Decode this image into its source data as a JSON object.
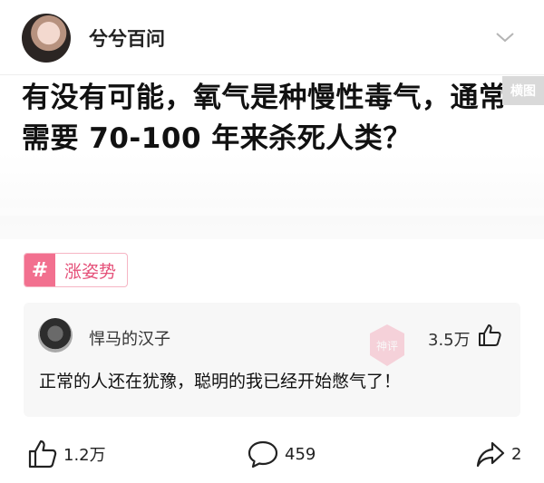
{
  "header": {
    "author_name": "兮兮百问",
    "avatar_icon": "user-avatar",
    "expand_icon": "chevron-down-icon"
  },
  "post": {
    "title": "有没有可能，氧气是种慢性毒气，通常需要 70-100 年来杀死人类？",
    "image_badge": "横图"
  },
  "topic": {
    "hash": "#",
    "label": "涨姿势"
  },
  "top_comment": {
    "user": "悍马的汉子",
    "likes": "3.5万",
    "text": "正常的人还在犹豫，聪明的我已经开始憋气了！",
    "watermark": "神评"
  },
  "actions": {
    "like_count": "1.2万",
    "comment_count": "459",
    "share_count": "2"
  },
  "colors": {
    "topic_pink": "#f2708f",
    "topic_text": "#e5527a",
    "card_bg": "#f7f7f7"
  }
}
